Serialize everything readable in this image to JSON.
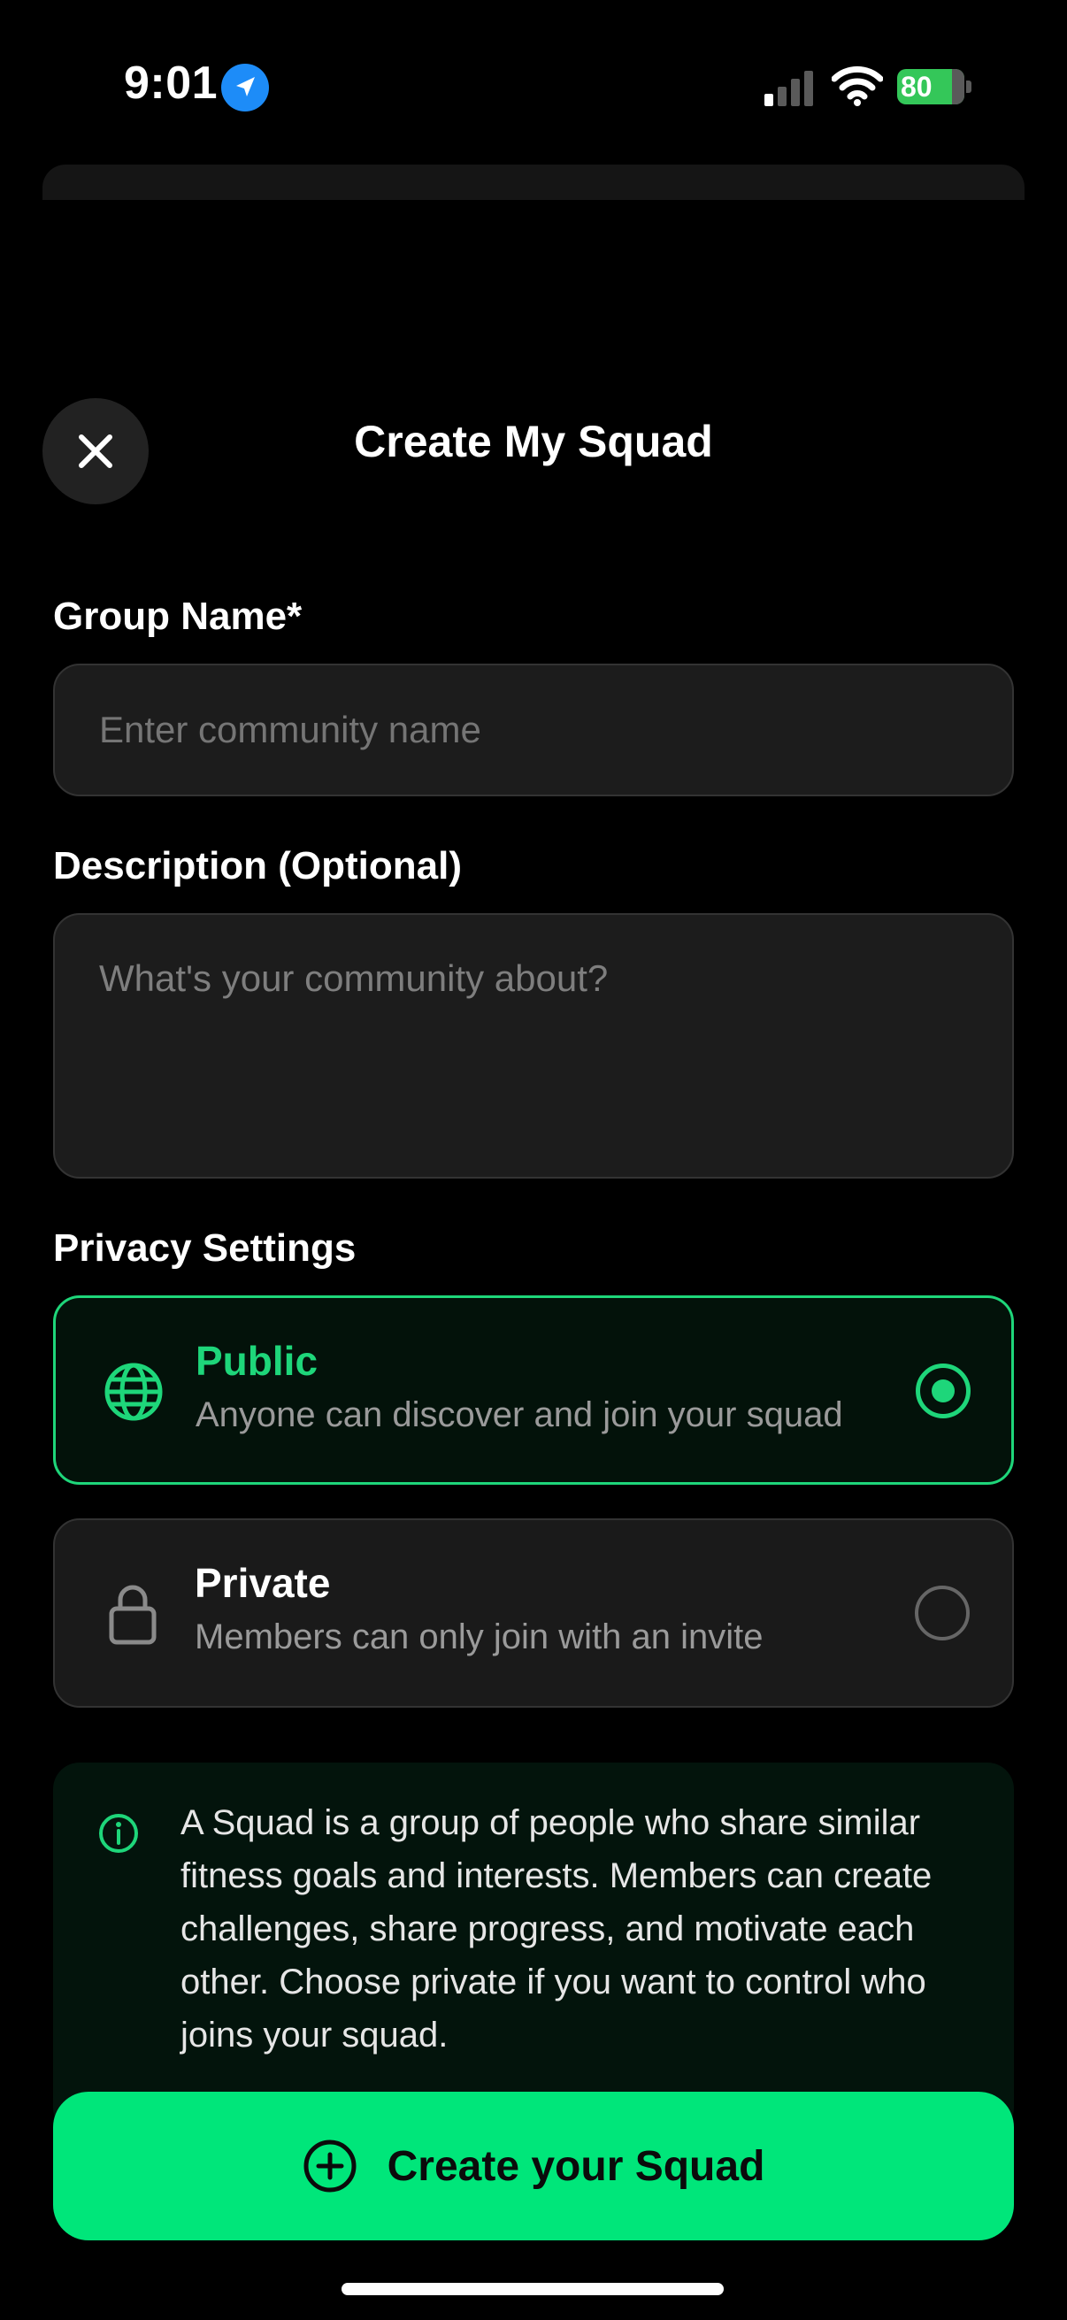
{
  "status_bar": {
    "time": "9:01",
    "battery": "80"
  },
  "header": {
    "title": "Create My Squad"
  },
  "group_name": {
    "label": "Group Name*",
    "placeholder": "Enter community name",
    "value": ""
  },
  "description": {
    "label": "Description (Optional)",
    "placeholder": "What's your community about?",
    "value": ""
  },
  "privacy": {
    "label": "Privacy Settings",
    "options": [
      {
        "title": "Public",
        "desc": "Anyone can discover and join your squad",
        "selected": true,
        "icon": "globe-icon"
      },
      {
        "title": "Private",
        "desc": "Members can only join with an invite",
        "selected": false,
        "icon": "lock-icon"
      }
    ]
  },
  "info": {
    "text": "A Squad is a group of people who share similar fitness goals and interests. Members can create challenges, share progress, and motivate each other. Choose private if you want to control who joins your squad."
  },
  "cta": {
    "label": "Create your Squad"
  },
  "colors": {
    "accent": "#00e67a",
    "background": "#000000"
  }
}
